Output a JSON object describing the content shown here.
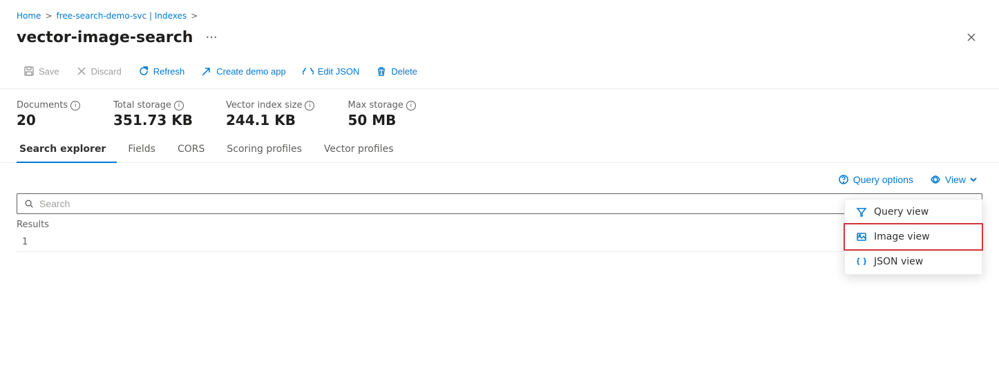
{
  "breadcrumb": {
    "home": "Home",
    "service": "free-search-demo-svc | Indexes",
    "sep1": ">",
    "sep2": ">"
  },
  "title": {
    "text": "vector-image-search",
    "ellipsis": "···"
  },
  "toolbar": {
    "save_label": "Save",
    "discard_label": "Discard",
    "refresh_label": "Refresh",
    "create_demo_label": "Create demo app",
    "edit_json_label": "Edit JSON",
    "delete_label": "Delete"
  },
  "metrics": [
    {
      "label": "Documents",
      "value": "20"
    },
    {
      "label": "Total storage",
      "value": "351.73 KB"
    },
    {
      "label": "Vector index size",
      "value": "244.1 KB"
    },
    {
      "label": "Max storage",
      "value": "50 MB"
    }
  ],
  "tabs": [
    {
      "label": "Search explorer",
      "active": true
    },
    {
      "label": "Fields",
      "active": false
    },
    {
      "label": "CORS",
      "active": false
    },
    {
      "label": "Scoring profiles",
      "active": false
    },
    {
      "label": "Vector profiles",
      "active": false
    }
  ],
  "query_options_label": "Query options",
  "view_label": "View",
  "search_placeholder": "Search",
  "results_label": "Results",
  "results_row_1": "1",
  "dropdown": {
    "items": [
      {
        "label": "Query view",
        "icon": "filter"
      },
      {
        "label": "Image view",
        "icon": "image",
        "highlighted": true
      },
      {
        "label": "JSON view",
        "icon": "braces"
      }
    ]
  },
  "colors": {
    "accent": "#0078d4",
    "border": "#edebe9",
    "text_muted": "#605e5c",
    "highlight_border": "#d13438"
  }
}
